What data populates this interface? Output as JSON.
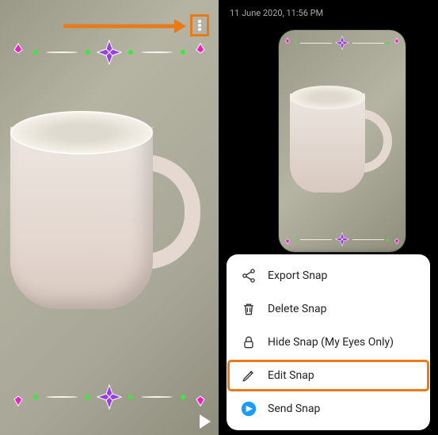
{
  "left": {
    "annotation_target": "more-options"
  },
  "right": {
    "timestamp": "11 June 2020, 11:56 PM",
    "menu": {
      "items": [
        {
          "icon": "share",
          "label": "Export Snap"
        },
        {
          "icon": "trash",
          "label": "Delete Snap"
        },
        {
          "icon": "lock",
          "label": "Hide Snap (My Eyes Only)"
        },
        {
          "icon": "pencil",
          "label": "Edit Snap",
          "highlighted": true
        },
        {
          "icon": "send",
          "label": "Send Snap"
        }
      ]
    }
  },
  "colors": {
    "accent_annotation": "#e87a1a",
    "send_icon": "#1a9cff",
    "flower_center": "#9c3ee6",
    "flower_side": "#f01fc5",
    "deco_dot": "#3ee63e"
  }
}
